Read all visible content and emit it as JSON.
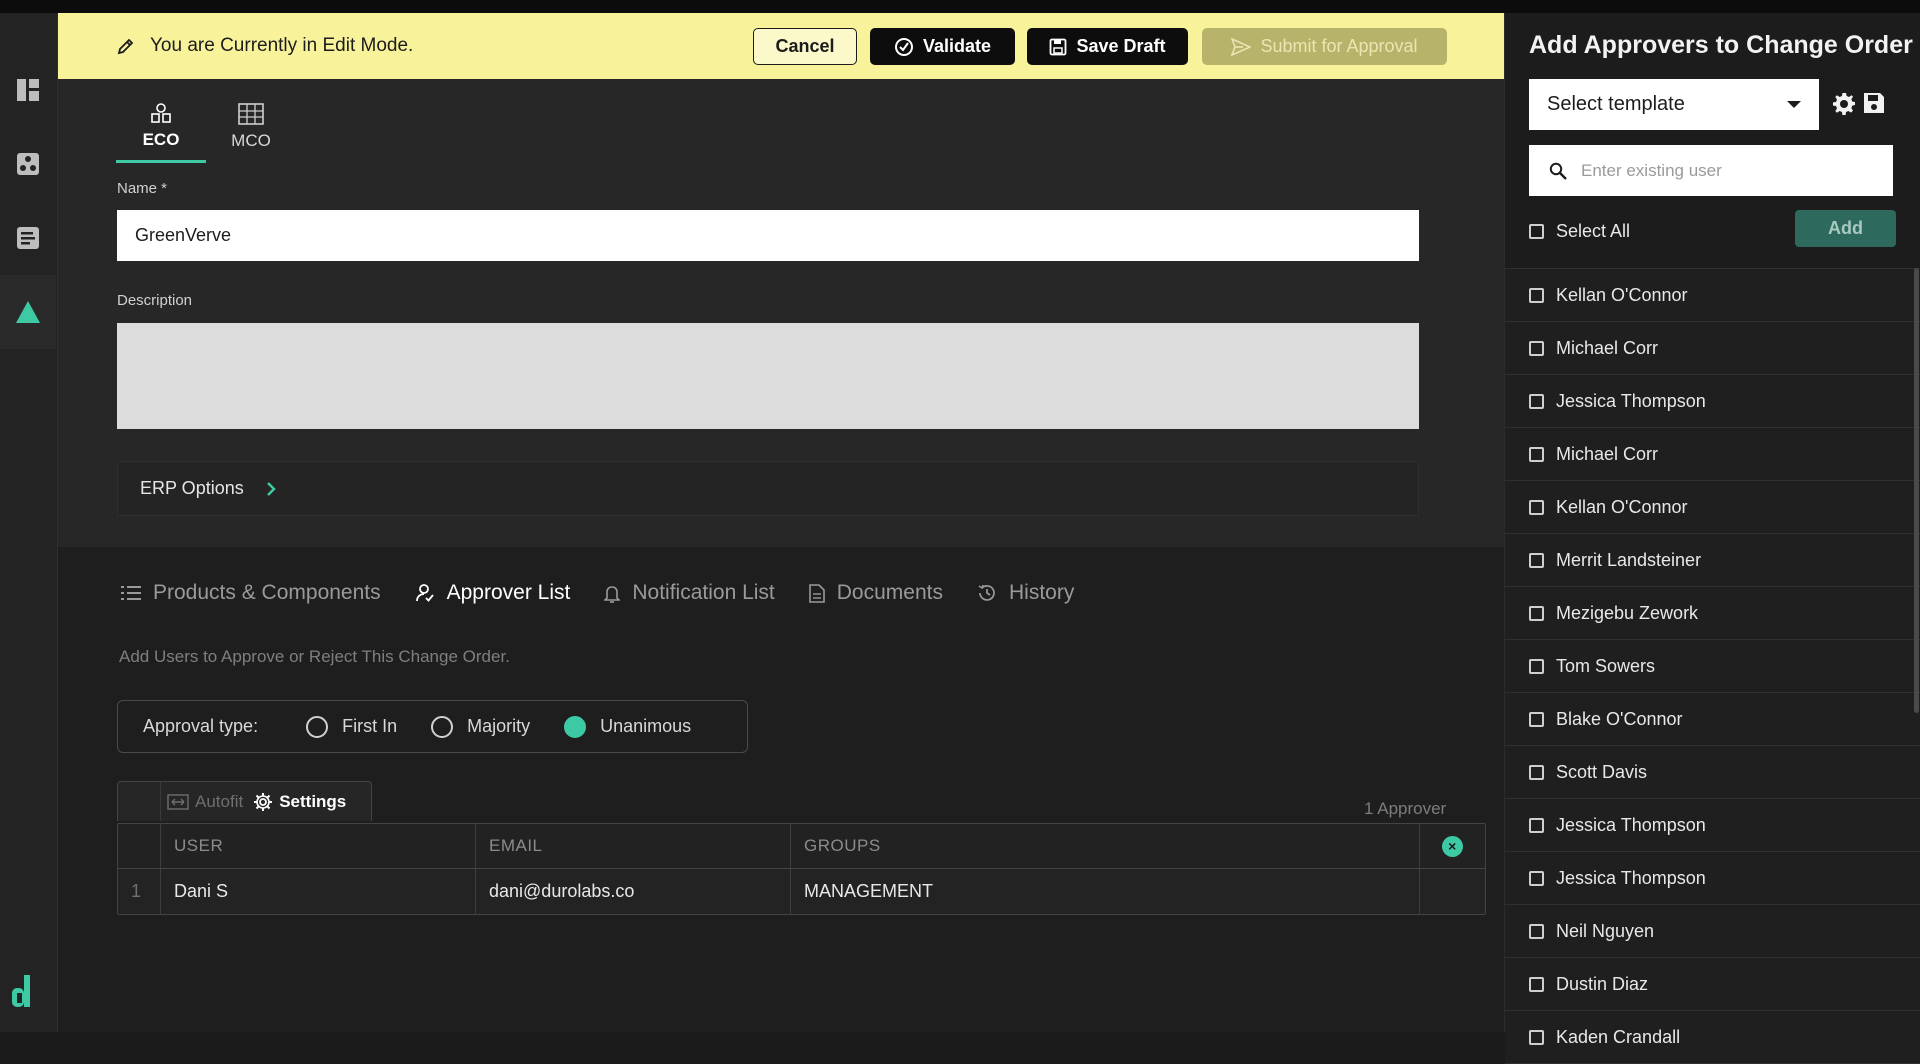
{
  "edit_bar": {
    "message": "You are Currently in Edit Mode.",
    "cancel": "Cancel",
    "validate": "Validate",
    "save_draft": "Save Draft",
    "submit": "Submit for Approval"
  },
  "top_tabs": [
    {
      "label": "ECO",
      "active": true,
      "icon": "eco-icon"
    },
    {
      "label": "MCO",
      "active": false,
      "icon": "building-icon"
    }
  ],
  "form": {
    "name_label": "Name *",
    "name_value": "GreenVerve",
    "description_label": "Description",
    "description_value": "",
    "erp_label": "ERP Options"
  },
  "lower_tabs": [
    {
      "label": "Products & Components",
      "icon": "list-icon",
      "active": false
    },
    {
      "label": "Approver List",
      "icon": "user-check-icon",
      "active": true
    },
    {
      "label": "Notification List",
      "icon": "bell-icon",
      "active": false
    },
    {
      "label": "Documents",
      "icon": "document-icon",
      "active": false
    },
    {
      "label": "History",
      "icon": "history-icon",
      "active": false
    }
  ],
  "approver_section": {
    "hint": "Add Users to Approve or Reject This Change Order.",
    "approval_type_label": "Approval type:",
    "options": [
      "First In",
      "Majority",
      "Unanimous"
    ],
    "selected": "Unanimous",
    "autofit_label": "Autofit",
    "settings_label": "Settings",
    "count_text": "1 Approver"
  },
  "table": {
    "headers": [
      "USER",
      "EMAIL",
      "GROUPS"
    ],
    "rows": [
      {
        "index": "1",
        "user": "Dani S",
        "email": "dani@durolabs.co",
        "groups": "MANAGEMENT"
      }
    ]
  },
  "right_panel": {
    "title": "Add Approvers to Change Order",
    "template_placeholder": "Select template",
    "search_placeholder": "Enter existing user",
    "select_all": "Select All",
    "add_button": "Add",
    "users": [
      "Kellan O'Connor",
      "Michael Corr",
      "Jessica Thompson",
      "Michael Corr",
      "Kellan O'Connor",
      "Merrit Landsteiner",
      "Mezigebu Zework",
      "Tom Sowers",
      "Blake O'Connor",
      "Scott Davis",
      "Jessica Thompson",
      "Jessica Thompson",
      "Neil Nguyen",
      "Dustin Diaz",
      "Kaden Crandall"
    ]
  },
  "colors": {
    "accent": "#3cc9a4",
    "edit_bar": "#f8f39b",
    "add_button": "#2d6a5d"
  }
}
